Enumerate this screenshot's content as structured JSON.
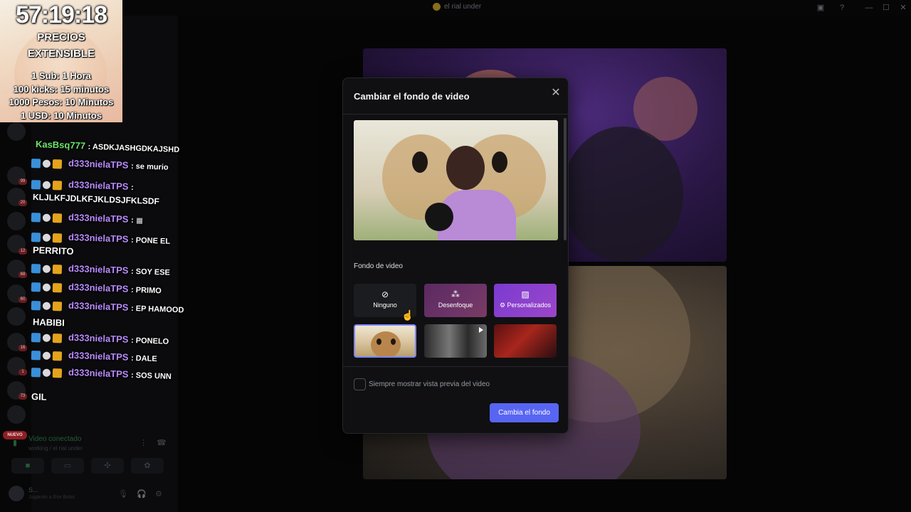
{
  "window": {
    "title": "el rial under",
    "controls": {
      "minimize": "—",
      "maximize": "☐",
      "close": "✕"
    }
  },
  "stream_timer": {
    "time": "57:19:18",
    "lines": [
      "PRECIOS",
      "EXTENSIBLE",
      "1 Sub: 1 Hora",
      "100 kicks: 15 minutos",
      "1000 Pesos: 10 Minutos",
      "1 USD: 10 Minutos"
    ]
  },
  "chat": [
    {
      "user": "KasBsq777",
      "text": ": ASDKJASHGDKAJSHD",
      "badges": false
    },
    {
      "user": "d333nielaTPS",
      "text": ": se murio",
      "badges": true
    },
    {
      "user": "d333nielaTPS",
      "text": ":",
      "badges": true,
      "cont": "KLJLKFJDLKFJKLDSJFKLSDF"
    },
    {
      "user": "d333nielaTPS",
      "text": ":",
      "badges": true
    },
    {
      "user": "d333nielaTPS",
      "text": ": PONE EL",
      "badges": true,
      "cont": "PERRITO"
    },
    {
      "user": "d333nielaTPS",
      "text": ": SOY ESE",
      "badges": true
    },
    {
      "user": "d333nielaTPS",
      "text": ": PRIMO",
      "badges": true
    },
    {
      "user": "d333nielaTPS",
      "text": ": EP HAMOOD",
      "badges": true,
      "cont": "HABIBI"
    },
    {
      "user": "d333nielaTPS",
      "text": ": PONELO",
      "badges": true
    },
    {
      "user": "d333nielaTPS",
      "text": ": DALE",
      "badges": true
    },
    {
      "user": "d333nielaTPS",
      "text": ": SOS UNN",
      "badges": true,
      "cont": "GIL"
    }
  ],
  "server_badges": [
    "99",
    "20",
    "12",
    "68",
    "60",
    "16",
    "1",
    "73"
  ],
  "nuevo_label": "NUEVO",
  "voice": {
    "status": "Video conectado",
    "channel": "working / el rial under"
  },
  "user": {
    "name": "S...",
    "activity": "Jugando a Ese Bobo"
  },
  "modal": {
    "title": "Cambiar el fondo de video",
    "section_label": "Fondo de video",
    "options": [
      {
        "label": "Ninguno",
        "icon": "ban-icon"
      },
      {
        "label": "Desenfoque",
        "icon": "blur-icon"
      },
      {
        "label": "Personalizados",
        "icon": "custom-image-icon"
      }
    ],
    "checkbox_label": "Siempre mostrar vista previa del video",
    "submit_label": "Cambia el fondo",
    "accent_color": "#5865f2"
  }
}
